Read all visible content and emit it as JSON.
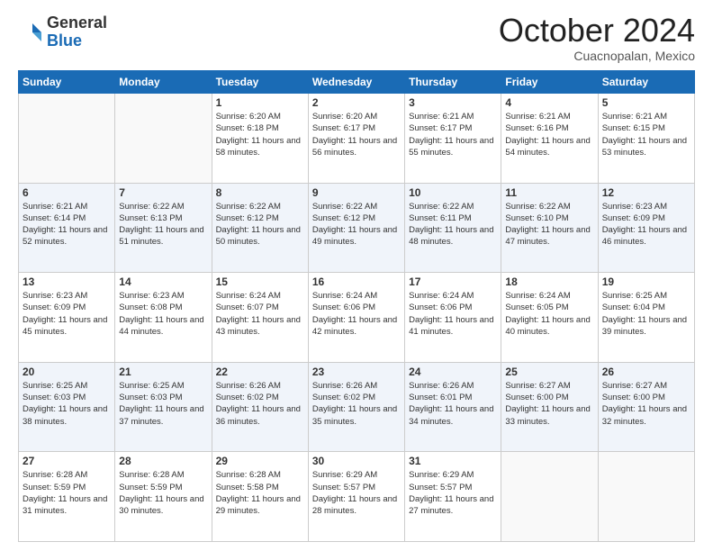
{
  "header": {
    "logo_line1": "General",
    "logo_line2": "Blue",
    "month": "October 2024",
    "location": "Cuacnopalan, Mexico"
  },
  "weekdays": [
    "Sunday",
    "Monday",
    "Tuesday",
    "Wednesday",
    "Thursday",
    "Friday",
    "Saturday"
  ],
  "weeks": [
    [
      {
        "day": "",
        "sunrise": "",
        "sunset": "",
        "daylight": ""
      },
      {
        "day": "",
        "sunrise": "",
        "sunset": "",
        "daylight": ""
      },
      {
        "day": "1",
        "sunrise": "Sunrise: 6:20 AM",
        "sunset": "Sunset: 6:18 PM",
        "daylight": "Daylight: 11 hours and 58 minutes."
      },
      {
        "day": "2",
        "sunrise": "Sunrise: 6:20 AM",
        "sunset": "Sunset: 6:17 PM",
        "daylight": "Daylight: 11 hours and 56 minutes."
      },
      {
        "day": "3",
        "sunrise": "Sunrise: 6:21 AM",
        "sunset": "Sunset: 6:17 PM",
        "daylight": "Daylight: 11 hours and 55 minutes."
      },
      {
        "day": "4",
        "sunrise": "Sunrise: 6:21 AM",
        "sunset": "Sunset: 6:16 PM",
        "daylight": "Daylight: 11 hours and 54 minutes."
      },
      {
        "day": "5",
        "sunrise": "Sunrise: 6:21 AM",
        "sunset": "Sunset: 6:15 PM",
        "daylight": "Daylight: 11 hours and 53 minutes."
      }
    ],
    [
      {
        "day": "6",
        "sunrise": "Sunrise: 6:21 AM",
        "sunset": "Sunset: 6:14 PM",
        "daylight": "Daylight: 11 hours and 52 minutes."
      },
      {
        "day": "7",
        "sunrise": "Sunrise: 6:22 AM",
        "sunset": "Sunset: 6:13 PM",
        "daylight": "Daylight: 11 hours and 51 minutes."
      },
      {
        "day": "8",
        "sunrise": "Sunrise: 6:22 AM",
        "sunset": "Sunset: 6:12 PM",
        "daylight": "Daylight: 11 hours and 50 minutes."
      },
      {
        "day": "9",
        "sunrise": "Sunrise: 6:22 AM",
        "sunset": "Sunset: 6:12 PM",
        "daylight": "Daylight: 11 hours and 49 minutes."
      },
      {
        "day": "10",
        "sunrise": "Sunrise: 6:22 AM",
        "sunset": "Sunset: 6:11 PM",
        "daylight": "Daylight: 11 hours and 48 minutes."
      },
      {
        "day": "11",
        "sunrise": "Sunrise: 6:22 AM",
        "sunset": "Sunset: 6:10 PM",
        "daylight": "Daylight: 11 hours and 47 minutes."
      },
      {
        "day": "12",
        "sunrise": "Sunrise: 6:23 AM",
        "sunset": "Sunset: 6:09 PM",
        "daylight": "Daylight: 11 hours and 46 minutes."
      }
    ],
    [
      {
        "day": "13",
        "sunrise": "Sunrise: 6:23 AM",
        "sunset": "Sunset: 6:09 PM",
        "daylight": "Daylight: 11 hours and 45 minutes."
      },
      {
        "day": "14",
        "sunrise": "Sunrise: 6:23 AM",
        "sunset": "Sunset: 6:08 PM",
        "daylight": "Daylight: 11 hours and 44 minutes."
      },
      {
        "day": "15",
        "sunrise": "Sunrise: 6:24 AM",
        "sunset": "Sunset: 6:07 PM",
        "daylight": "Daylight: 11 hours and 43 minutes."
      },
      {
        "day": "16",
        "sunrise": "Sunrise: 6:24 AM",
        "sunset": "Sunset: 6:06 PM",
        "daylight": "Daylight: 11 hours and 42 minutes."
      },
      {
        "day": "17",
        "sunrise": "Sunrise: 6:24 AM",
        "sunset": "Sunset: 6:06 PM",
        "daylight": "Daylight: 11 hours and 41 minutes."
      },
      {
        "day": "18",
        "sunrise": "Sunrise: 6:24 AM",
        "sunset": "Sunset: 6:05 PM",
        "daylight": "Daylight: 11 hours and 40 minutes."
      },
      {
        "day": "19",
        "sunrise": "Sunrise: 6:25 AM",
        "sunset": "Sunset: 6:04 PM",
        "daylight": "Daylight: 11 hours and 39 minutes."
      }
    ],
    [
      {
        "day": "20",
        "sunrise": "Sunrise: 6:25 AM",
        "sunset": "Sunset: 6:03 PM",
        "daylight": "Daylight: 11 hours and 38 minutes."
      },
      {
        "day": "21",
        "sunrise": "Sunrise: 6:25 AM",
        "sunset": "Sunset: 6:03 PM",
        "daylight": "Daylight: 11 hours and 37 minutes."
      },
      {
        "day": "22",
        "sunrise": "Sunrise: 6:26 AM",
        "sunset": "Sunset: 6:02 PM",
        "daylight": "Daylight: 11 hours and 36 minutes."
      },
      {
        "day": "23",
        "sunrise": "Sunrise: 6:26 AM",
        "sunset": "Sunset: 6:02 PM",
        "daylight": "Daylight: 11 hours and 35 minutes."
      },
      {
        "day": "24",
        "sunrise": "Sunrise: 6:26 AM",
        "sunset": "Sunset: 6:01 PM",
        "daylight": "Daylight: 11 hours and 34 minutes."
      },
      {
        "day": "25",
        "sunrise": "Sunrise: 6:27 AM",
        "sunset": "Sunset: 6:00 PM",
        "daylight": "Daylight: 11 hours and 33 minutes."
      },
      {
        "day": "26",
        "sunrise": "Sunrise: 6:27 AM",
        "sunset": "Sunset: 6:00 PM",
        "daylight": "Daylight: 11 hours and 32 minutes."
      }
    ],
    [
      {
        "day": "27",
        "sunrise": "Sunrise: 6:28 AM",
        "sunset": "Sunset: 5:59 PM",
        "daylight": "Daylight: 11 hours and 31 minutes."
      },
      {
        "day": "28",
        "sunrise": "Sunrise: 6:28 AM",
        "sunset": "Sunset: 5:59 PM",
        "daylight": "Daylight: 11 hours and 30 minutes."
      },
      {
        "day": "29",
        "sunrise": "Sunrise: 6:28 AM",
        "sunset": "Sunset: 5:58 PM",
        "daylight": "Daylight: 11 hours and 29 minutes."
      },
      {
        "day": "30",
        "sunrise": "Sunrise: 6:29 AM",
        "sunset": "Sunset: 5:57 PM",
        "daylight": "Daylight: 11 hours and 28 minutes."
      },
      {
        "day": "31",
        "sunrise": "Sunrise: 6:29 AM",
        "sunset": "Sunset: 5:57 PM",
        "daylight": "Daylight: 11 hours and 27 minutes."
      },
      {
        "day": "",
        "sunrise": "",
        "sunset": "",
        "daylight": ""
      },
      {
        "day": "",
        "sunrise": "",
        "sunset": "",
        "daylight": ""
      }
    ]
  ]
}
